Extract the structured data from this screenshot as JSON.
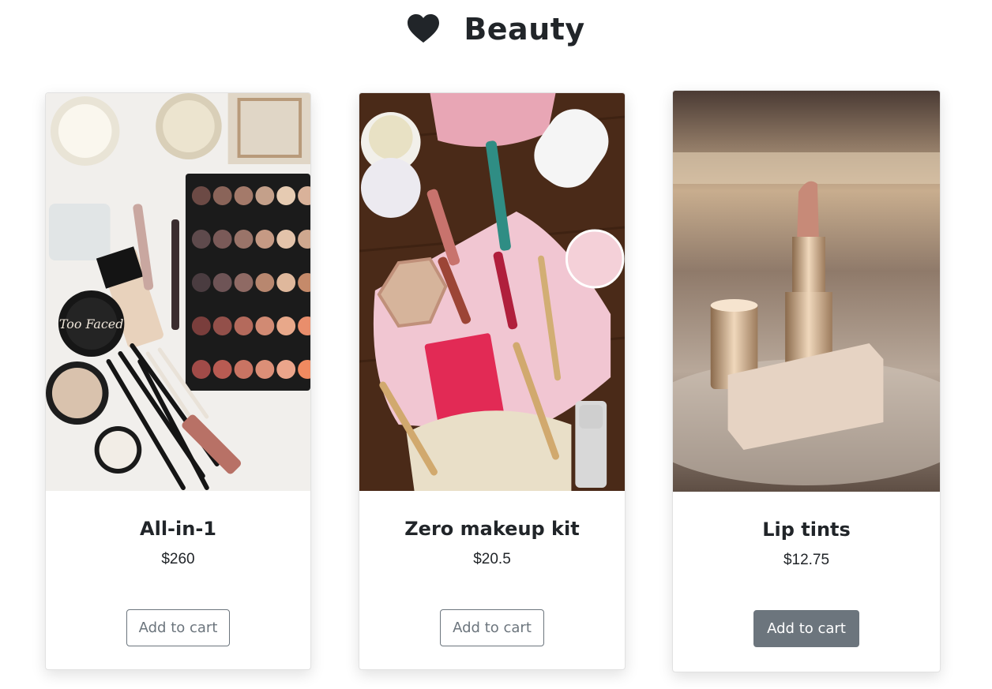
{
  "header": {
    "icon": "heart-icon",
    "title": "Beauty"
  },
  "products": [
    {
      "name": "All-in-1",
      "price": "$260",
      "button_label": "Add to cart",
      "image": "makeup flat-lay with eyeshadow palette, candles and brushes"
    },
    {
      "name": "Zero makeup kit",
      "price": "$20.5",
      "button_label": "Add to cart",
      "image": "makeup kit on pink towel with brushes and palette"
    },
    {
      "name": "Lip tints",
      "price": "$12.75",
      "button_label": "Add to cart",
      "image": "lipstick on mirrored tray"
    }
  ],
  "colors": {
    "text": "#212529",
    "button_outline": "#6c757d",
    "button_active_bg": "#6c757d"
  }
}
